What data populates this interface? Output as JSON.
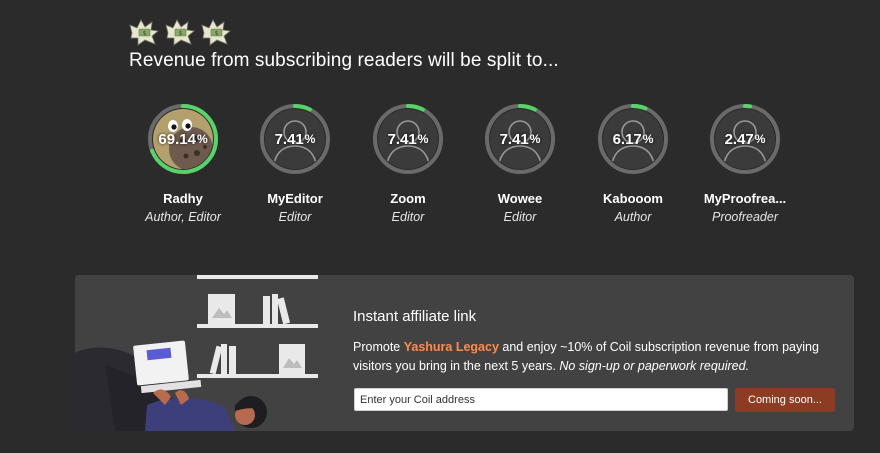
{
  "icons": [
    "money-bag-icon",
    "money-bag-icon",
    "money-bag-icon"
  ],
  "headline": "Revenue from subscribing readers will be split to...",
  "colors": {
    "ring_track": "#6a6a6a",
    "ring_fill": "#57d36a",
    "accent_brand": "#ff8a4c",
    "button_bg": "#8e3b24",
    "panel_bg": "#424242"
  },
  "contributors": [
    {
      "name": "Radhy",
      "role": "Author, Editor",
      "percent": "69.14",
      "share": 0.6914,
      "avatar": "cookie-avatar"
    },
    {
      "name": "MyEditor",
      "role": "Editor",
      "percent": "7.41",
      "share": 0.0741,
      "avatar": "default-avatar"
    },
    {
      "name": "Zoom",
      "role": "Editor",
      "percent": "7.41",
      "share": 0.0741,
      "avatar": "default-avatar"
    },
    {
      "name": "Wowee",
      "role": "Editor",
      "percent": "7.41",
      "share": 0.0741,
      "avatar": "default-avatar"
    },
    {
      "name": "Kabooom",
      "role": "Author",
      "percent": "6.17",
      "share": 0.0617,
      "avatar": "default-avatar"
    },
    {
      "name": "MyProofrea...",
      "role": "Proofreader",
      "percent": "2.47",
      "share": 0.0247,
      "avatar": "default-avatar"
    }
  ],
  "percent_unit": "%",
  "affiliate": {
    "title": "Instant affiliate link",
    "text_before": "Promote ",
    "brand": "Yashura Legacy",
    "text_after": " and enjoy ~10% of Coil subscription revenue from paying visitors you bring in the next 5 years. ",
    "text_italic": "No sign-up or paperwork required.",
    "input_placeholder": "Enter your Coil address",
    "button_label": "Coming soon..."
  }
}
